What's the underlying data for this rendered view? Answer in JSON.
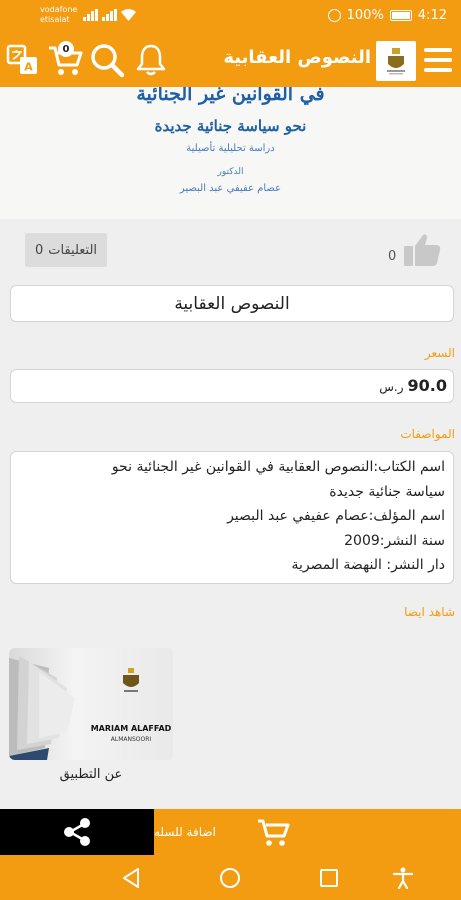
{
  "status_bar": {
    "carrier1": "vodafone",
    "carrier2": "etisalat",
    "battery": "100%",
    "time": "4:12"
  },
  "app_bar": {
    "title": "النصوص العقابية",
    "cart_count": "0"
  },
  "cover": {
    "line1": "في القوانين غير الجنائية",
    "line2": "نحو سياسة جنائية جديدة",
    "line3": "دراسة تحليلية تأصيلية",
    "line4": "الدكتور",
    "line5": "عصام عفيفي عبد البصير"
  },
  "engagement": {
    "likes": "0",
    "comments_count": "0",
    "comments_label": "التعليقات"
  },
  "product": {
    "name": "النصوص العقابية",
    "price_label": "السعر",
    "price": "90.0",
    "currency": "ر.س",
    "specs_label": "المواصفات",
    "specs": [
      "اسم الكتاب:النصوص العقابية في القوانين غير الجنائية نحو",
      "سياسة جنائية جديدة",
      "اسم المؤلف:عصام عفيفي عبد البصير",
      "سنة النشر:2009",
      "دار النشر: النهضة المصرية"
    ]
  },
  "related": {
    "label": "شاهد ايضا",
    "items": [
      {
        "logo_text1": "MARIAM ALAFFAD",
        "logo_text2": "ALMANSOORI",
        "caption": "عن التطبيق"
      }
    ]
  },
  "actions": {
    "add_to_cart": "اضافة للسله"
  },
  "colors": {
    "accent": "#f39c12",
    "share_bg": "#000000"
  },
  "icons": {
    "translate": "translate-icon",
    "cart": "cart-icon",
    "search": "search-icon",
    "bell": "bell-icon",
    "menu": "menu-icon",
    "like": "thumbs-up-icon",
    "share": "share-icon"
  }
}
